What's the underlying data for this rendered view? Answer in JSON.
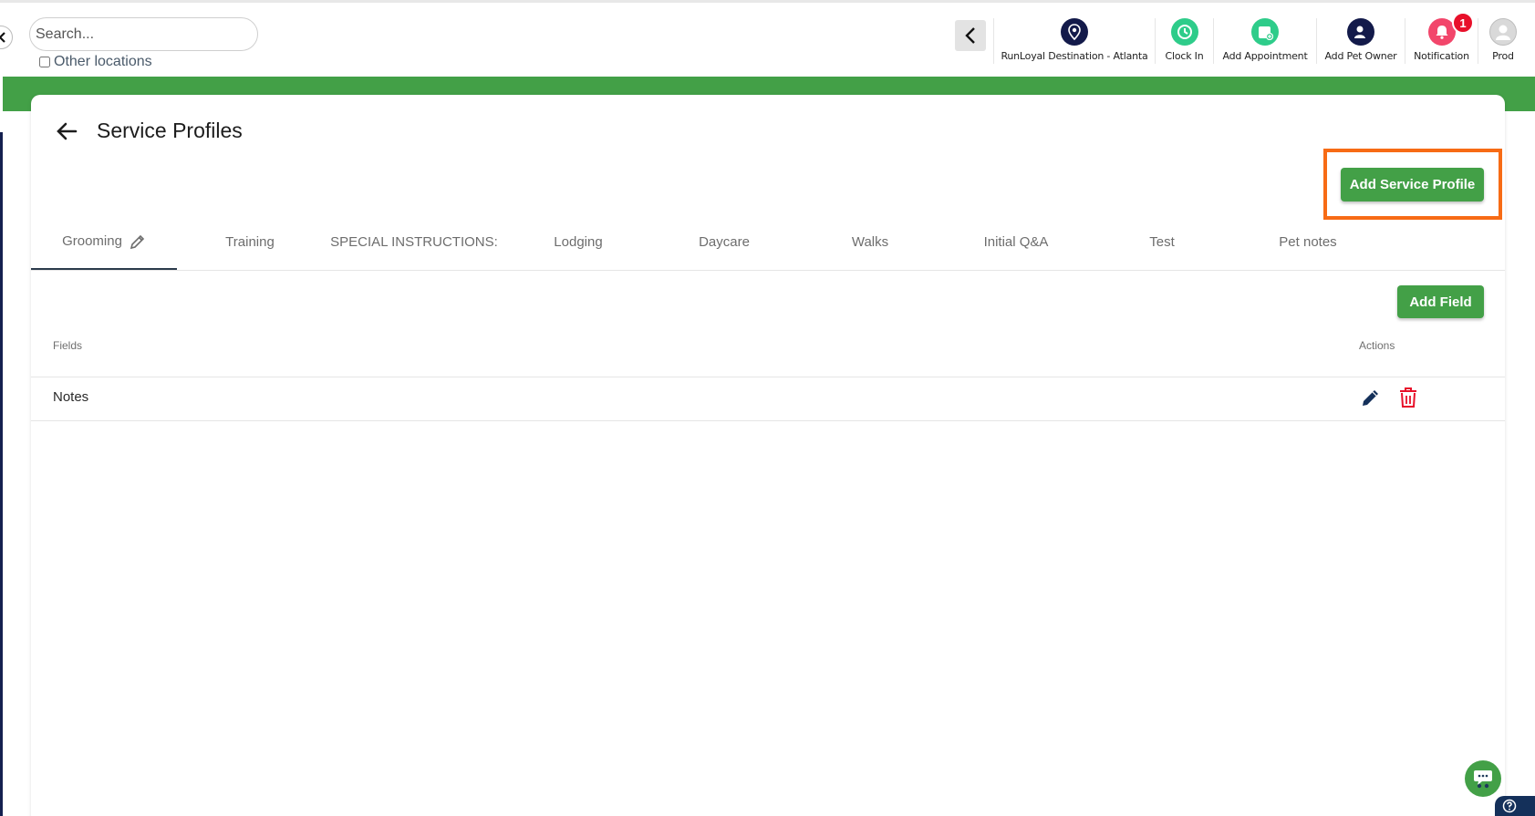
{
  "search": {
    "placeholder": "Search...",
    "other_locations_label": "Other locations"
  },
  "nav": {
    "location_label": "RunLoyal Destination - Atlanta",
    "clock_in_label": "Clock In",
    "add_appointment_label": "Add Appointment",
    "add_pet_owner_label": "Add Pet Owner",
    "notification_label": "Notification",
    "notification_count": "1",
    "profile_label": "Prod"
  },
  "page": {
    "title": "Service Profiles",
    "add_profile_label": "Add Service Profile"
  },
  "tabs": [
    {
      "label": "Grooming"
    },
    {
      "label": "Training"
    },
    {
      "label": "SPECIAL INSTRUCTIONS:"
    },
    {
      "label": "Lodging"
    },
    {
      "label": "Daycare"
    },
    {
      "label": "Walks"
    },
    {
      "label": "Initial Q&A"
    },
    {
      "label": "Test"
    },
    {
      "label": "Pet notes"
    }
  ],
  "table": {
    "add_field_label": "Add Field",
    "col_fields": "Fields",
    "col_actions": "Actions",
    "rows": [
      {
        "field": "Notes"
      }
    ]
  },
  "colors": {
    "brand_green": "#43a047",
    "highlight_orange": "#f76b15",
    "navy": "#14204f",
    "delete_red": "#e8102a"
  }
}
